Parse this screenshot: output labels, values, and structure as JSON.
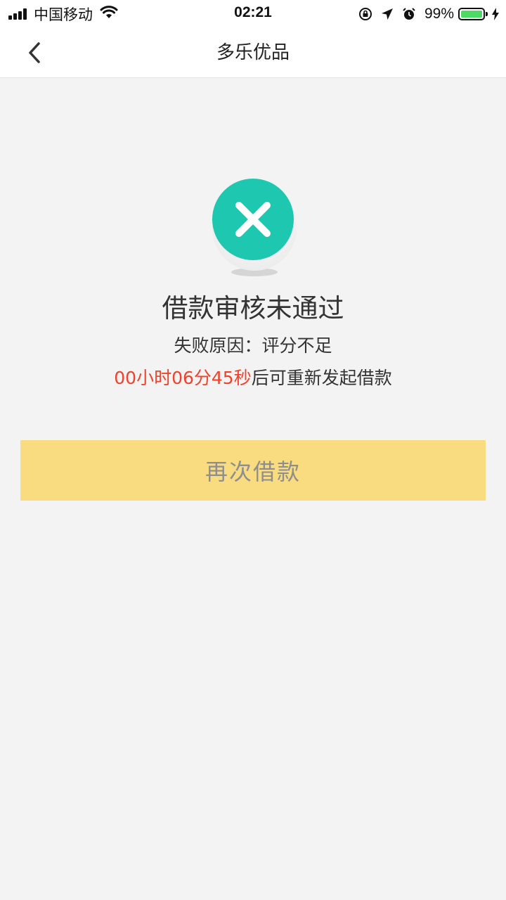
{
  "status_bar": {
    "carrier": "中国移动",
    "time": "02:21",
    "battery": "99%",
    "battery_level": 0.99
  },
  "nav": {
    "title": "多乐优品",
    "back_icon": "chevron-left-icon"
  },
  "result": {
    "icon": "close-circle-icon",
    "icon_color": "#1ec8b0",
    "title": "借款审核未通过",
    "reason": "失败原因：评分不足",
    "countdown_timer": "00小时06分45秒",
    "countdown_suffix": "后可重新发起借款",
    "timer_color": "#f0412a"
  },
  "actions": {
    "retry_label": "再次借款",
    "retry_color": "#f9db80"
  }
}
